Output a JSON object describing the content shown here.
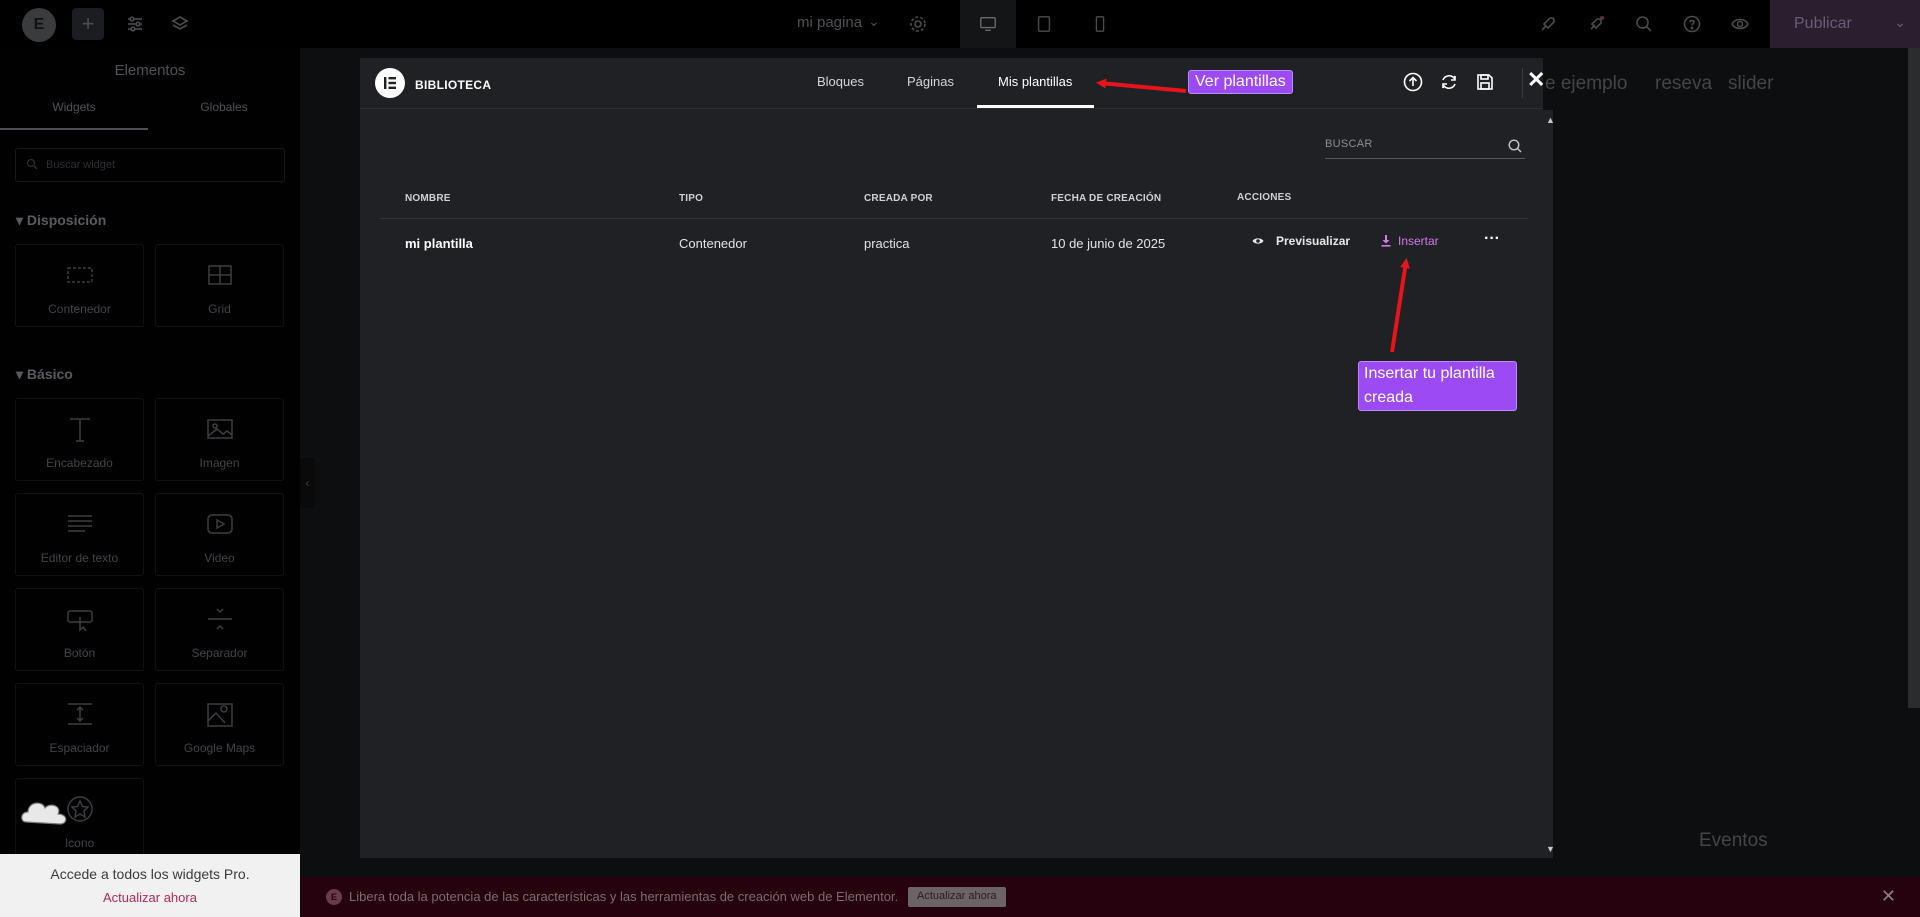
{
  "topbar": {
    "logo_letter": "E",
    "page_title": "mi pagina",
    "publish_label": "Publicar"
  },
  "sidebar": {
    "title": "Elementos",
    "tabs": [
      "Widgets",
      "Globales"
    ],
    "search_placeholder": "Buscar widget",
    "categories": [
      {
        "label": "Disposición"
      },
      {
        "label": "Básico"
      }
    ],
    "widgets": {
      "contenedor": "Contenedor",
      "grid": "Grid",
      "encabezado": "Encabezado",
      "imagen": "Imagen",
      "editor": "Editor de texto",
      "video": "Video",
      "boton": "Botón",
      "separador": "Separador",
      "espaciador": "Espaciador",
      "maps": "Google Maps",
      "icono": "Icono"
    },
    "promo_text": "Accede a todos los widgets Pro.",
    "promo_link": "Actualizar ahora"
  },
  "canvas": {
    "nav_items": [
      "e ejemplo",
      "reseva",
      "slider"
    ],
    "footer_text": "Eventos"
  },
  "banner": {
    "text": "Libera toda la potencia de las características y las herramientas de creación web de Elementor.",
    "button": "Actualizar ahora",
    "close": "✕"
  },
  "modal": {
    "title": "BIBLIOTECA",
    "tabs": [
      "Bloques",
      "Páginas",
      "Mis plantillas"
    ],
    "active_tab": "Mis plantillas",
    "close": "✕",
    "search_placeholder": "BUSCAR",
    "columns": [
      "NOMBRE",
      "TIPO",
      "CREADA POR",
      "FECHA DE CREACIÓN",
      "ACCIONES"
    ],
    "rows": [
      {
        "name": "mi plantilla",
        "type": "Contenedor",
        "author": "practica",
        "date": "10 de junio de 2025",
        "preview_label": "Previsualizar",
        "insert_label": "Insertar",
        "more": "···"
      }
    ]
  },
  "annotations": {
    "tabs_note": "Ver plantillas",
    "insert_note": "Insertar tu plantilla creada",
    "color": "#9c4af3",
    "arrow_color": "#e8141c"
  },
  "colors": {
    "accent": "#d07be8",
    "modal_bg": "#202124",
    "banner_bg": "#26020f"
  }
}
